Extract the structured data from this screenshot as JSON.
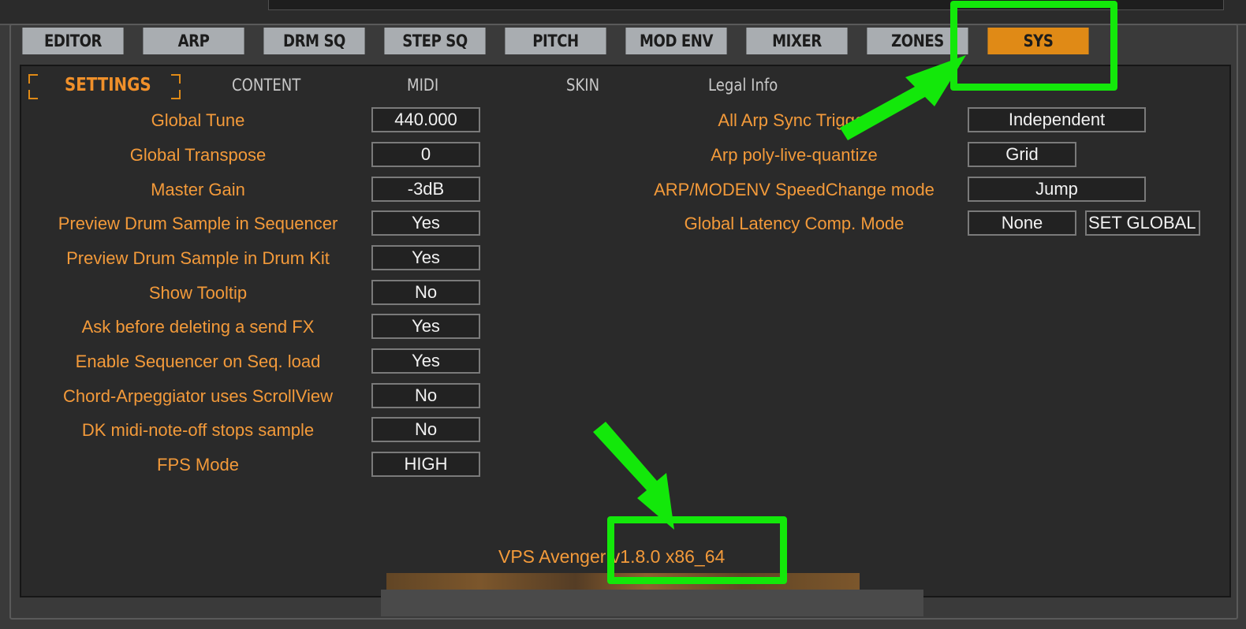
{
  "tabs": [
    "EDITOR",
    "ARP",
    "DRM SQ",
    "STEP SQ",
    "PITCH",
    "MOD ENV",
    "MIXER",
    "ZONES",
    "SYS"
  ],
  "active_tab": "SYS",
  "subtabs": {
    "settings": "SETTINGS",
    "content": "CONTENT",
    "midi": "MIDI",
    "skin": "SKIN",
    "legal": "Legal Info"
  },
  "left_settings": [
    {
      "label": "Global Tune",
      "value": "440.000"
    },
    {
      "label": "Global Transpose",
      "value": "0"
    },
    {
      "label": "Master Gain",
      "value": "-3dB"
    },
    {
      "label": "Preview Drum Sample in Sequencer",
      "value": "Yes"
    },
    {
      "label": "Preview Drum Sample in Drum Kit",
      "value": "Yes"
    },
    {
      "label": "Show Tooltip",
      "value": "No"
    },
    {
      "label": "Ask before deleting a send FX",
      "value": "Yes"
    },
    {
      "label": "Enable Sequencer on Seq. load",
      "value": "Yes"
    },
    {
      "label": "Chord-Arpeggiator uses ScrollView",
      "value": "No"
    },
    {
      "label": "DK midi-note-off stops sample",
      "value": "No"
    },
    {
      "label": "FPS Mode",
      "value": "HIGH"
    }
  ],
  "right_settings": [
    {
      "label": "All Arp Sync Trigger",
      "value": "Independent"
    },
    {
      "label": "Arp poly-live-quantize",
      "value": "Grid"
    },
    {
      "label": "ARP/MODENV SpeedChange mode",
      "value": "Jump"
    },
    {
      "label": "Global Latency Comp. Mode",
      "value": "None"
    }
  ],
  "set_global_label": "SET GLOBAL",
  "version": {
    "product": "VPS Avenger",
    "version": "v1.8.0 x86_64"
  },
  "colors": {
    "accent": "#e08a16",
    "label": "#f39a3a",
    "highlight": "#13e80a"
  }
}
